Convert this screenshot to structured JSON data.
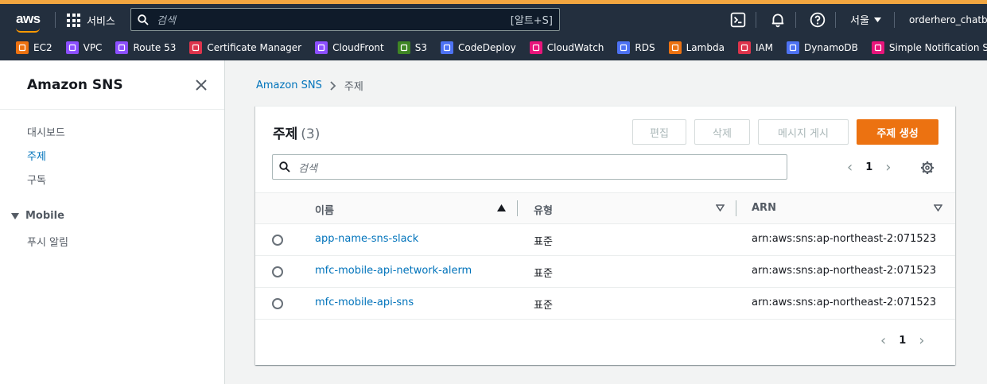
{
  "topnav": {
    "logo": "aws",
    "services_label": "서비스",
    "search_placeholder": "검색",
    "search_shortcut": "[알트+S]",
    "region": "서울",
    "account": "orderhero_chatbo",
    "icons": [
      "cloudshell-icon",
      "bell-icon",
      "help-icon"
    ]
  },
  "favorites": [
    {
      "label": "EC2",
      "color": "#ec7211",
      "icon": "ec2-icon"
    },
    {
      "label": "VPC",
      "color": "#8c4fff",
      "icon": "vpc-icon"
    },
    {
      "label": "Route 53",
      "color": "#8c4fff",
      "icon": "route53-icon"
    },
    {
      "label": "Certificate Manager",
      "color": "#dd344c",
      "icon": "certificate-manager-icon"
    },
    {
      "label": "CloudFront",
      "color": "#8c4fff",
      "icon": "cloudfront-icon"
    },
    {
      "label": "S3",
      "color": "#3f8624",
      "icon": "s3-icon"
    },
    {
      "label": "CodeDeploy",
      "color": "#4d72f3",
      "icon": "codedeploy-icon"
    },
    {
      "label": "CloudWatch",
      "color": "#e7157b",
      "icon": "cloudwatch-icon"
    },
    {
      "label": "RDS",
      "color": "#4d72f3",
      "icon": "rds-icon"
    },
    {
      "label": "Lambda",
      "color": "#ec7211",
      "icon": "lambda-icon"
    },
    {
      "label": "IAM",
      "color": "#dd344c",
      "icon": "iam-icon"
    },
    {
      "label": "DynamoDB",
      "color": "#4d72f3",
      "icon": "dynamodb-icon"
    },
    {
      "label": "Simple Notification Service",
      "color": "#e7157b",
      "icon": "sns-icon"
    }
  ],
  "sidebar": {
    "title": "Amazon SNS",
    "items": [
      {
        "label": "대시보드",
        "active": false
      },
      {
        "label": "주제",
        "active": true
      },
      {
        "label": "구독",
        "active": false
      }
    ],
    "section_label": "Mobile",
    "section_items": [
      {
        "label": "푸시 알림"
      }
    ]
  },
  "breadcrumb": {
    "root": "Amazon SNS",
    "current": "주제"
  },
  "topics": {
    "title": "주제",
    "count": "(3)",
    "buttons": {
      "edit": "편집",
      "delete": "삭제",
      "publish": "메시지 게시",
      "create": "주제 생성"
    },
    "search_placeholder": "검색",
    "page": "1",
    "columns": {
      "name": "이름",
      "type": "유형",
      "arn": "ARN"
    },
    "rows": [
      {
        "name": "app-name-sns-slack",
        "type": "표준",
        "arn": "arn:aws:sns:ap-northeast-2:071523"
      },
      {
        "name": "mfc-mobile-api-network-alerm",
        "type": "표준",
        "arn": "arn:aws:sns:ap-northeast-2:071523"
      },
      {
        "name": "mfc-mobile-api-sns",
        "type": "표준",
        "arn": "arn:aws:sns:ap-northeast-2:071523"
      }
    ],
    "bottom_page": "1"
  },
  "colors": {
    "brand_orange": "#ec7211",
    "link": "#0073bb",
    "nav_bg": "#232f3e",
    "accent_bar": "#f2a640"
  }
}
